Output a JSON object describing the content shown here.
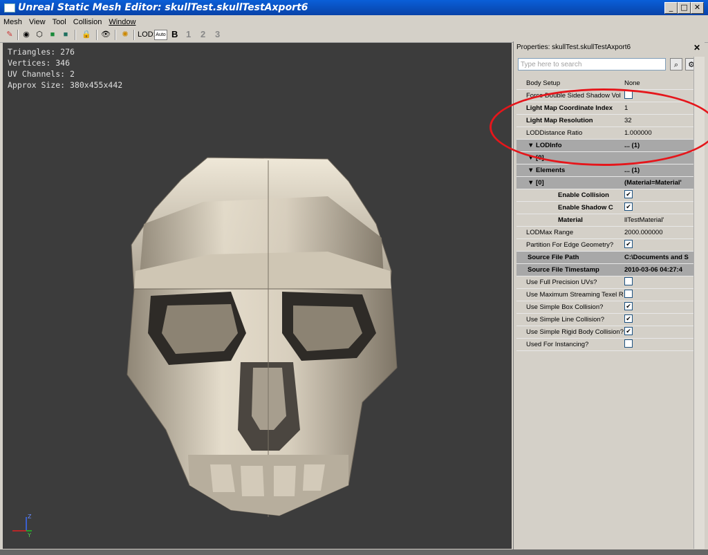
{
  "window": {
    "title": "Unreal Static Mesh Editor: skullTest.skullTestAxport6",
    "minimize": "_",
    "maximize": "□",
    "close": "✕"
  },
  "menu": [
    "Mesh",
    "View",
    "Tool",
    "Collision",
    "Window"
  ],
  "toolbar": {
    "lod_label": "LOD:",
    "lod_value": "Auto",
    "lod_levels": [
      "B",
      "1",
      "2",
      "3"
    ]
  },
  "viewport": {
    "stats": [
      "Triangles: 276",
      "Vertices: 346",
      "UV Channels: 2",
      "Approx Size: 380x455x442"
    ],
    "axis_labels": {
      "z": "Z",
      "y": "Y",
      "x": "X"
    }
  },
  "properties": {
    "title": "Properties: skullTest.skullTestAxport6",
    "close": "✕",
    "search_placeholder": "Type here to search",
    "rows": [
      {
        "name": "Body Setup",
        "value": "None"
      },
      {
        "name": "Force Double Sided Shadow Vol",
        "value": "",
        "check": false
      },
      {
        "name": "Light Map Coordinate Index",
        "value": "1",
        "bold": true
      },
      {
        "name": "Light Map Resolution",
        "value": "32",
        "bold": true
      },
      {
        "name": "LODDistance Ratio",
        "value": "1.000000"
      },
      {
        "name": "▼ LODInfo",
        "value": "... (1)",
        "cat": true
      },
      {
        "name": "▼ [0]",
        "value": "",
        "cat": true
      },
      {
        "name": "▼ Elements",
        "value": "... (1)",
        "cat": true
      },
      {
        "name": "▼ [0]",
        "value": "(Material=Material'",
        "cat": true
      },
      {
        "name": "Enable Collision",
        "value": "",
        "check": true,
        "bold": true
      },
      {
        "name": "Enable Shadow C",
        "value": "",
        "check": true,
        "bold": true
      },
      {
        "name": "Material",
        "value": "llTestMaterial'",
        "bold": true
      },
      {
        "name": "LODMax Range",
        "value": "2000.000000"
      },
      {
        "name": "Partition For Edge Geometry?",
        "value": "",
        "check": true
      },
      {
        "name": "Source File Path",
        "value": "C:\\Documents and S",
        "cat": true
      },
      {
        "name": "Source File Timestamp",
        "value": "2010-03-06 04:27:4",
        "cat": true
      },
      {
        "name": "Use Full Precision UVs?",
        "value": "",
        "check": false
      },
      {
        "name": "Use Maximum Streaming Texel R",
        "value": "",
        "check": false
      },
      {
        "name": "Use Simple Box Collision?",
        "value": "",
        "check": true
      },
      {
        "name": "Use Simple Line Collision?",
        "value": "",
        "check": true
      },
      {
        "name": "Use Simple Rigid Body Collision?",
        "value": "",
        "check": true
      },
      {
        "name": "Used For Instancing?",
        "value": "",
        "check": false
      }
    ]
  },
  "colors": {
    "viewport_bg": "#3c3c3c",
    "annotation_ring": "#e5161b",
    "titlebar": "#0a5fd8"
  }
}
